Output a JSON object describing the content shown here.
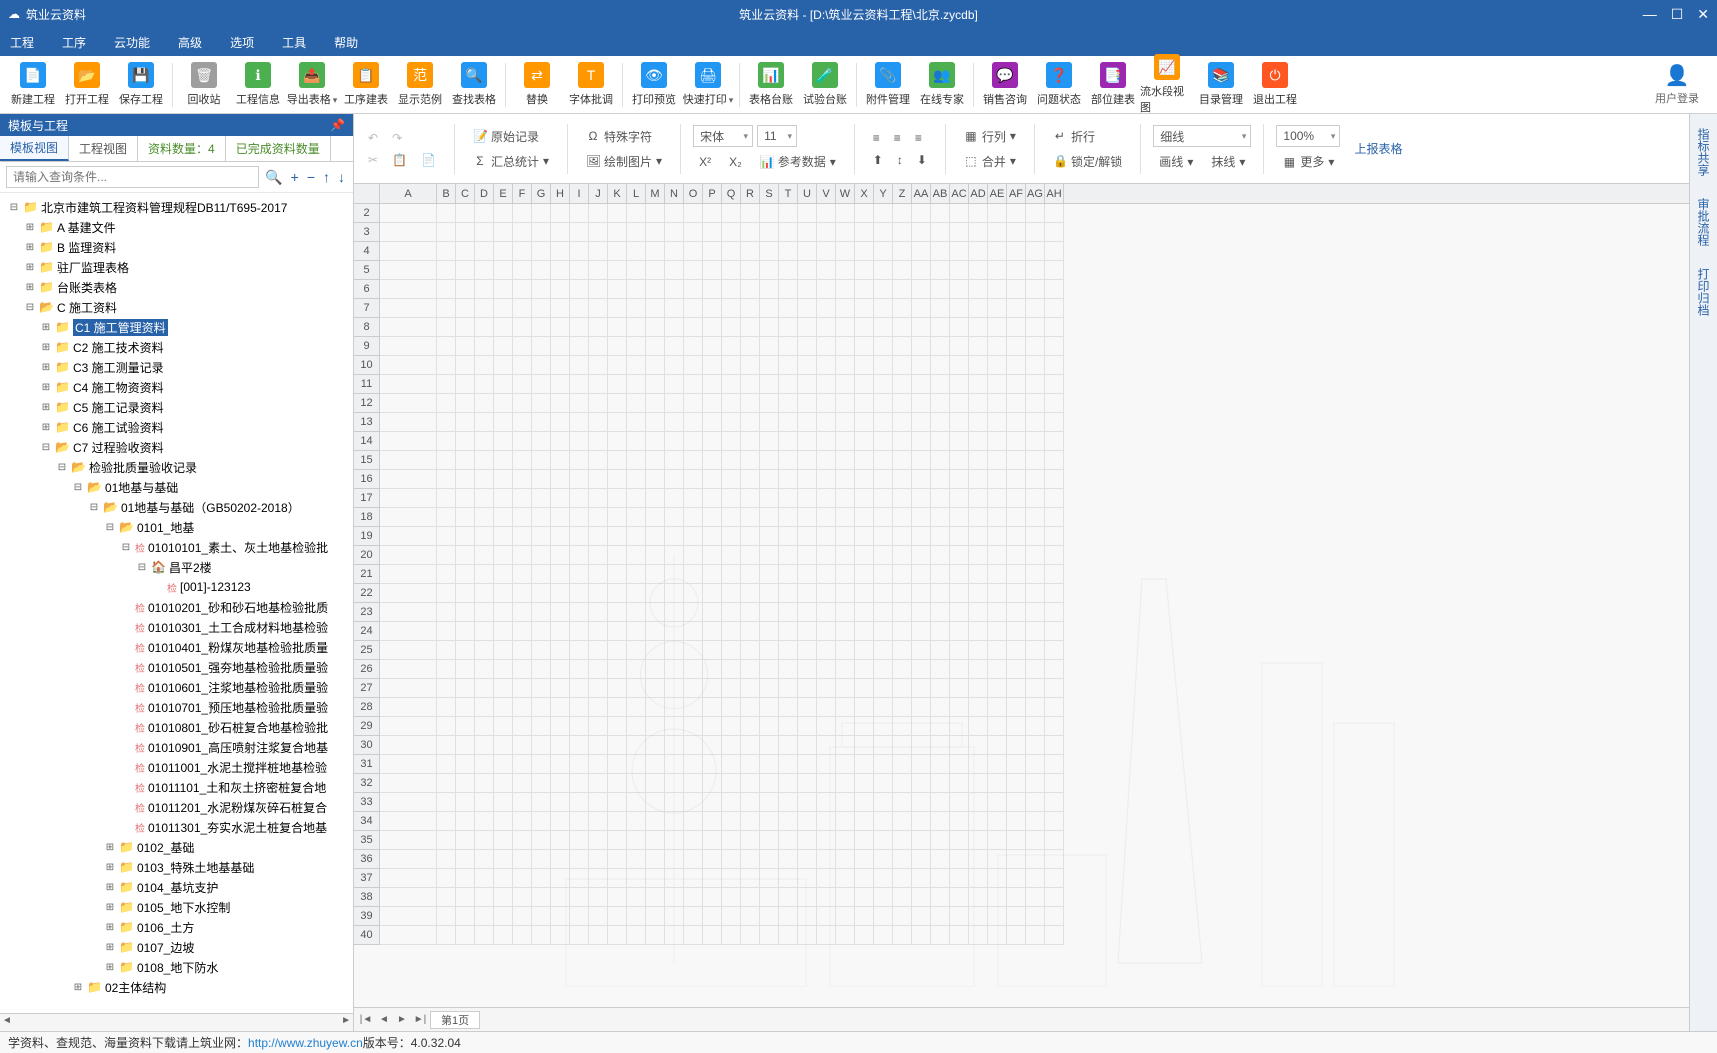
{
  "title": {
    "app": "筑业云资料",
    "doc": "筑业云资料 - [D:\\筑业云资料工程\\北京.zycdb]"
  },
  "menus": [
    "工程",
    "工序",
    "云功能",
    "高级",
    "选项",
    "工具",
    "帮助"
  ],
  "tools": [
    {
      "label": "新建工程",
      "color": "#2196f3",
      "glyph": "📄",
      "dd": false
    },
    {
      "label": "打开工程",
      "color": "#ff9800",
      "glyph": "📂",
      "dd": false
    },
    {
      "label": "保存工程",
      "color": "#2196f3",
      "glyph": "💾",
      "dd": false
    },
    {
      "sep": true
    },
    {
      "label": "回收站",
      "color": "#9e9e9e",
      "glyph": "🗑",
      "dd": false
    },
    {
      "label": "工程信息",
      "color": "#4caf50",
      "glyph": "ℹ",
      "dd": false
    },
    {
      "label": "导出表格",
      "color": "#4caf50",
      "glyph": "📤",
      "dd": true
    },
    {
      "label": "工序建表",
      "color": "#ff9800",
      "glyph": "📋",
      "dd": false
    },
    {
      "label": "显示范例",
      "color": "#ff9800",
      "glyph": "范",
      "dd": false
    },
    {
      "label": "查找表格",
      "color": "#2196f3",
      "glyph": "🔍",
      "dd": false
    },
    {
      "sep": true
    },
    {
      "label": "替换",
      "color": "#ff9800",
      "glyph": "⇄",
      "dd": false
    },
    {
      "label": "字体批调",
      "color": "#ff9800",
      "glyph": "T",
      "dd": false
    },
    {
      "sep": true
    },
    {
      "label": "打印预览",
      "color": "#2196f3",
      "glyph": "👁",
      "dd": false
    },
    {
      "label": "快速打印",
      "color": "#2196f3",
      "glyph": "🖨",
      "dd": true
    },
    {
      "sep": true
    },
    {
      "label": "表格台账",
      "color": "#4caf50",
      "glyph": "📊",
      "dd": false
    },
    {
      "label": "试验台账",
      "color": "#4caf50",
      "glyph": "🧪",
      "dd": false
    },
    {
      "sep": true
    },
    {
      "label": "附件管理",
      "color": "#2196f3",
      "glyph": "📎",
      "dd": false
    },
    {
      "label": "在线专家",
      "color": "#4caf50",
      "glyph": "👥",
      "dd": false
    },
    {
      "sep": true
    },
    {
      "label": "销售咨询",
      "color": "#9c27b0",
      "glyph": "💬",
      "dd": false
    },
    {
      "label": "问题状态",
      "color": "#2196f3",
      "glyph": "❓",
      "dd": false
    },
    {
      "label": "部位建表",
      "color": "#9c27b0",
      "glyph": "📑",
      "dd": false
    },
    {
      "label": "流水段视图",
      "color": "#ff9800",
      "glyph": "📈",
      "dd": false
    },
    {
      "label": "目录管理",
      "color": "#2196f3",
      "glyph": "📚",
      "dd": false
    },
    {
      "label": "退出工程",
      "color": "#ff5722",
      "glyph": "⏻",
      "dd": false
    }
  ],
  "user": {
    "label": "用户登录"
  },
  "sidepanel": {
    "title": "模板与工程",
    "tabs": [
      "模板视图",
      "工程视图"
    ],
    "count_label": "资料数量：4",
    "done_label": "已完成资料数量",
    "search_ph": "请输入查询条件..."
  },
  "ribbon": {
    "orig": "原始记录",
    "spec": "特殊字符",
    "font": "宋体",
    "size": "11",
    "row": "行列",
    "wrap": "折行",
    "thin": "细线",
    "zoom": "100%",
    "upload": "上报表格",
    "stat": "汇总统计",
    "pic": "绘制图片",
    "ref": "参考数据",
    "merge": "合并",
    "lock": "锁定/解锁",
    "border": "画线",
    "eraseline": "抹线",
    "more": "更多"
  },
  "sheet": {
    "tab": "第1页"
  },
  "vside": [
    "指标共享",
    "审批流程",
    "打印归档"
  ],
  "status": {
    "text": "学资料、查规范、海量资料下载请上筑业网：",
    "url": "http://www.zhuyew.cn",
    "ver": "  版本号：4.0.32.04"
  },
  "tree": [
    {
      "d": 0,
      "e": "-",
      "i": "fx",
      "t": "北京市建筑工程资料管理规程DB11/T695-2017"
    },
    {
      "d": 1,
      "e": "+",
      "i": "folder",
      "t": "A 基建文件"
    },
    {
      "d": 1,
      "e": "+",
      "i": "folder",
      "t": "B 监理资料"
    },
    {
      "d": 1,
      "e": "+",
      "i": "folder",
      "t": "驻厂监理表格"
    },
    {
      "d": 1,
      "e": "+",
      "i": "folder",
      "t": "台账类表格"
    },
    {
      "d": 1,
      "e": "-",
      "i": "folder-open",
      "t": "C 施工资料"
    },
    {
      "d": 2,
      "e": "+",
      "i": "folder",
      "t": "C1 施工管理资料",
      "sel": true
    },
    {
      "d": 2,
      "e": "+",
      "i": "folder",
      "t": "C2 施工技术资料"
    },
    {
      "d": 2,
      "e": "+",
      "i": "folder",
      "t": "C3 施工测量记录"
    },
    {
      "d": 2,
      "e": "+",
      "i": "folder",
      "t": "C4 施工物资资料"
    },
    {
      "d": 2,
      "e": "+",
      "i": "folder",
      "t": "C5 施工记录资料"
    },
    {
      "d": 2,
      "e": "+",
      "i": "folder",
      "t": "C6 施工试验资料"
    },
    {
      "d": 2,
      "e": "-",
      "i": "folder-open",
      "t": "C7 过程验收资料"
    },
    {
      "d": 3,
      "e": "-",
      "i": "folder-open",
      "t": "检验批质量验收记录"
    },
    {
      "d": 4,
      "e": "-",
      "i": "folder-open",
      "t": "01地基与基础"
    },
    {
      "d": 5,
      "e": "-",
      "i": "folder-open",
      "t": "01地基与基础（GB50202-2018）"
    },
    {
      "d": 6,
      "e": "-",
      "i": "folder-open",
      "t": "0101_地基"
    },
    {
      "d": 7,
      "e": "-",
      "i": "chk",
      "t": "01010101_素土、灰土地基检验批"
    },
    {
      "d": 8,
      "e": "-",
      "i": "house",
      "t": "昌平2楼"
    },
    {
      "d": 9,
      "e": "",
      "i": "chk",
      "t": "[001]-123123"
    },
    {
      "d": 7,
      "e": "",
      "i": "chk",
      "t": "01010201_砂和砂石地基检验批质"
    },
    {
      "d": 7,
      "e": "",
      "i": "chk",
      "t": "01010301_土工合成材料地基检验"
    },
    {
      "d": 7,
      "e": "",
      "i": "chk",
      "t": "01010401_粉煤灰地基检验批质量"
    },
    {
      "d": 7,
      "e": "",
      "i": "chk",
      "t": "01010501_强夯地基检验批质量验"
    },
    {
      "d": 7,
      "e": "",
      "i": "chk",
      "t": "01010601_注浆地基检验批质量验"
    },
    {
      "d": 7,
      "e": "",
      "i": "chk",
      "t": "01010701_预压地基检验批质量验"
    },
    {
      "d": 7,
      "e": "",
      "i": "chk",
      "t": "01010801_砂石桩复合地基检验批"
    },
    {
      "d": 7,
      "e": "",
      "i": "chk",
      "t": "01010901_高压喷射注浆复合地基"
    },
    {
      "d": 7,
      "e": "",
      "i": "chk",
      "t": "01011001_水泥土搅拌桩地基检验"
    },
    {
      "d": 7,
      "e": "",
      "i": "chk",
      "t": "01011101_土和灰土挤密桩复合地"
    },
    {
      "d": 7,
      "e": "",
      "i": "chk",
      "t": "01011201_水泥粉煤灰碎石桩复合"
    },
    {
      "d": 7,
      "e": "",
      "i": "chk",
      "t": "01011301_夯实水泥土桩复合地基"
    },
    {
      "d": 6,
      "e": "+",
      "i": "folder",
      "t": "0102_基础"
    },
    {
      "d": 6,
      "e": "+",
      "i": "folder",
      "t": "0103_特殊土地基基础"
    },
    {
      "d": 6,
      "e": "+",
      "i": "folder",
      "t": "0104_基坑支护"
    },
    {
      "d": 6,
      "e": "+",
      "i": "folder",
      "t": "0105_地下水控制"
    },
    {
      "d": 6,
      "e": "+",
      "i": "folder",
      "t": "0106_土方"
    },
    {
      "d": 6,
      "e": "+",
      "i": "folder",
      "t": "0107_边坡"
    },
    {
      "d": 6,
      "e": "+",
      "i": "folder",
      "t": "0108_地下防水"
    },
    {
      "d": 4,
      "e": "+",
      "i": "folder",
      "t": "02主体结构"
    }
  ],
  "cols": [
    "B",
    "C",
    "D",
    "E",
    "F",
    "G",
    "H",
    "I",
    "J",
    "K",
    "L",
    "M",
    "N",
    "O",
    "P",
    "Q",
    "R",
    "S",
    "T",
    "U",
    "V",
    "W",
    "X",
    "Y",
    "Z",
    "AA",
    "AB",
    "AC",
    "AD",
    "AE",
    "AF",
    "AG",
    "AH"
  ]
}
